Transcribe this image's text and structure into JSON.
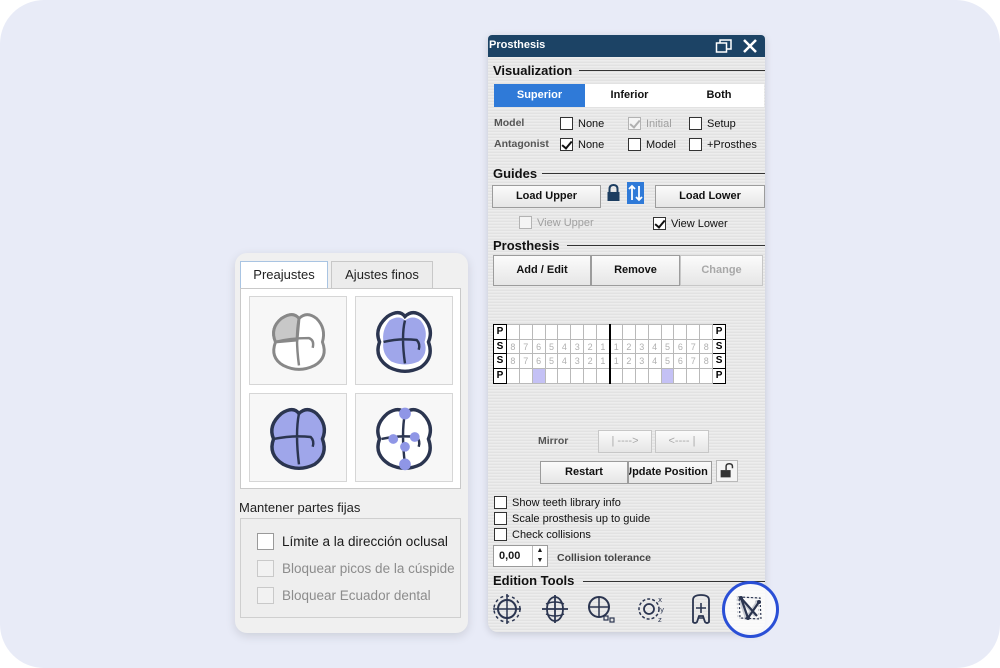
{
  "left_panel": {
    "tabs": [
      "Preajustes",
      "Ajustes finos"
    ],
    "active_tab": 0,
    "presets": [
      "preset-grey-outline",
      "preset-blue-fill-outline",
      "preset-full-blue",
      "preset-points"
    ],
    "fixed_parts_title": "Mantener partes fijas",
    "checkboxes": [
      {
        "label": "Límite a la dirección oclusal",
        "checked": false,
        "disabled": false
      },
      {
        "label": "Bloquear picos de la cúspide",
        "checked": false,
        "disabled": true
      },
      {
        "label": "Bloquear Ecuador dental",
        "checked": false,
        "disabled": true
      }
    ]
  },
  "prosthesis_window": {
    "title": "Prosthesis",
    "visualization": {
      "header": "Visualization",
      "segments": [
        "Superior",
        "Inferior",
        "Both"
      ],
      "active_segment": 0,
      "model_label": "Model",
      "antagonist_label": "Antagonist",
      "model_options": [
        {
          "label": "None",
          "checked": false,
          "disabled": false
        },
        {
          "label": "Initial",
          "checked": true,
          "disabled": true
        },
        {
          "label": "Setup",
          "checked": false,
          "disabled": false
        }
      ],
      "antagonist_options": [
        {
          "label": "None",
          "checked": true,
          "disabled": false
        },
        {
          "label": "Model",
          "checked": false,
          "disabled": false
        },
        {
          "label": "+Prosthes",
          "checked": false,
          "disabled": false
        }
      ]
    },
    "guides": {
      "header": "Guides",
      "load_upper": "Load Upper",
      "load_lower": "Load Lower",
      "view_upper": {
        "label": "View Upper",
        "checked": false,
        "disabled": true
      },
      "view_lower": {
        "label": "View Lower",
        "checked": true,
        "disabled": false
      }
    },
    "prosthesis": {
      "header": "Prosthesis",
      "add_edit": "Add / Edit",
      "remove": "Remove",
      "change": "Change",
      "tooth_rows": [
        {
          "edge": "P",
          "cells": [
            "",
            "",
            "",
            "",
            "",
            "",
            "",
            "",
            "",
            "",
            "",
            "",
            "",
            "",
            "",
            ""
          ]
        },
        {
          "edge": "S",
          "cells": [
            "8",
            "7",
            "6",
            "5",
            "4",
            "3",
            "2",
            "1",
            "1",
            "2",
            "3",
            "4",
            "5",
            "6",
            "7",
            "8"
          ]
        },
        {
          "edge": "S",
          "cells": [
            "8",
            "7",
            "6",
            "5",
            "4",
            "3",
            "2",
            "1",
            "1",
            "2",
            "3",
            "4",
            "5",
            "6",
            "7",
            "8"
          ]
        },
        {
          "edge": "P",
          "cells": [
            "",
            "",
            "",
            "",
            "",
            "",
            "",
            "",
            "",
            "",
            "",
            "",
            "",
            "",
            "",
            ""
          ],
          "selected": [
            2,
            12
          ]
        }
      ],
      "mirror_label": "Mirror",
      "mirror_right": "| ---->",
      "mirror_left": "<---- |",
      "restart": "Restart",
      "update_position": "Update Position",
      "options": [
        {
          "label": "Show teeth library info",
          "checked": false
        },
        {
          "label": "Scale prosthesis up to guide",
          "checked": false
        },
        {
          "label": "Check collisions",
          "checked": false
        }
      ],
      "collision_value": "0,00",
      "collision_label": "Collision tolerance"
    },
    "edition_tools": {
      "header": "Edition Tools",
      "tools": [
        "rotate-tool-icon",
        "axis-tool-icon",
        "scale-tool-icon",
        "xyz-tool-icon",
        "tooth-size-tool-icon",
        "deform-tool-icon"
      ],
      "highlighted_tool": 5
    }
  },
  "colors": {
    "titlebar": "#1c4365",
    "accent": "#2f7ad8",
    "selected_cell": "#c4c1f5",
    "highlight_ring": "#2a4fd6"
  }
}
